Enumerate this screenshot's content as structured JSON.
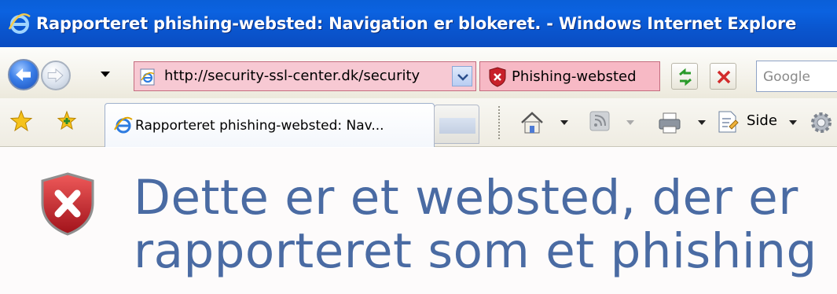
{
  "window": {
    "title": "Rapporteret phishing-websted: Navigation er blokeret. - Windows Internet Explore"
  },
  "address_bar": {
    "url": "http://security-ssl-center.dk/security",
    "phishing_label": "Phishing-websted"
  },
  "search": {
    "placeholder": "Google"
  },
  "tabs": [
    {
      "label": "Rapporteret phishing-websted: Nav..."
    }
  ],
  "command_bar": {
    "page_label": "Side"
  },
  "content": {
    "heading_line1": "Dette er et websted, der er",
    "heading_line2": "rapporteret som et phishing"
  },
  "colors": {
    "title_bar": "#0a5fd8",
    "phishing_highlight": "#f7b9c5",
    "heading_text": "#4a6ba3",
    "shield_red": "#c8202a"
  }
}
